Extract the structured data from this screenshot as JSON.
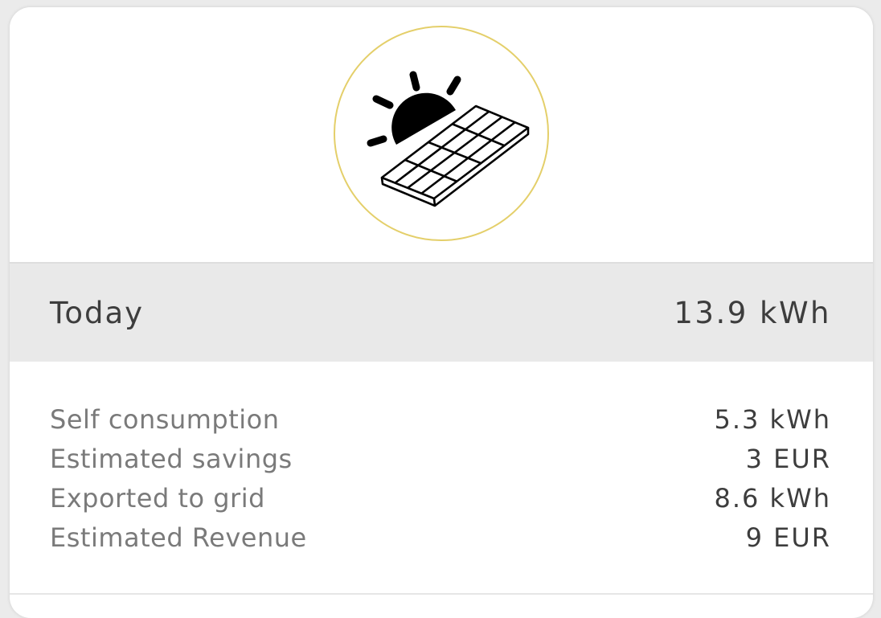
{
  "hero": {
    "icon": "solar-panel-sun-icon",
    "ring_color": "#e4cf6a"
  },
  "summary": {
    "label": "Today",
    "value": "13.9 kWh"
  },
  "details": {
    "rows": [
      {
        "label": "Self consumption",
        "value": "5.3 kWh"
      },
      {
        "label": "Estimated savings",
        "value": "3 EUR"
      },
      {
        "label": "Exported to grid",
        "value": "8.6 kWh"
      },
      {
        "label": "Estimated Revenue",
        "value": "9 EUR"
      }
    ]
  }
}
